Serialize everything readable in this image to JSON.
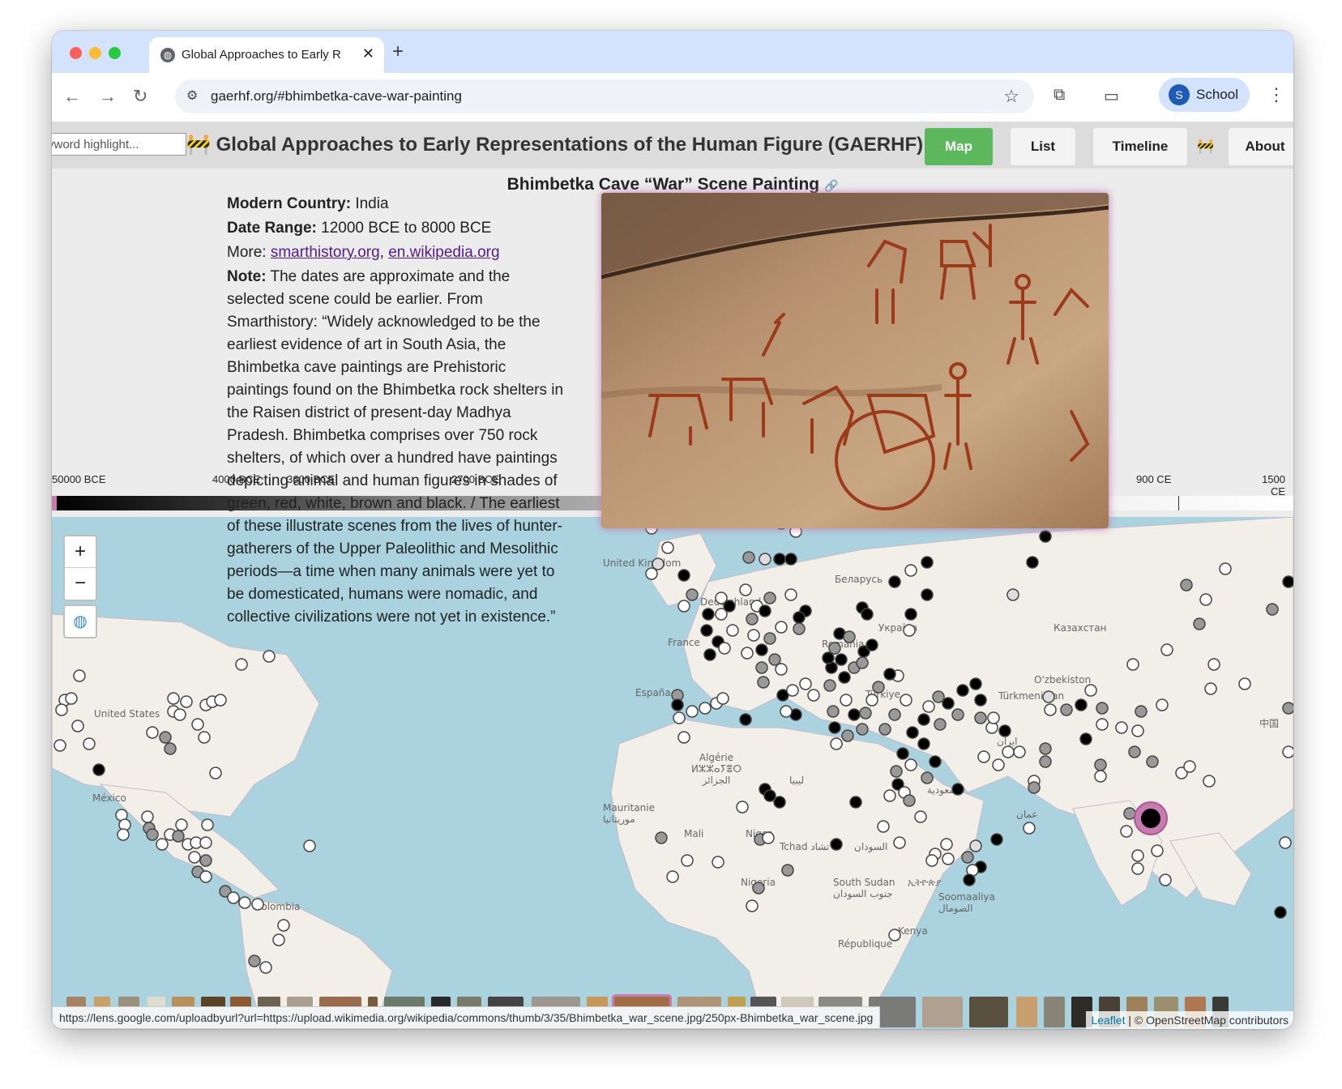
{
  "browser": {
    "tab_title": "Global Approaches to Early R",
    "url": "gaerhf.org/#bhimbetka-cave-war-painting",
    "profile_initial": "S",
    "profile_name": "School"
  },
  "site": {
    "keyword_placeholder": "Keyword highlight...",
    "keyword_visible": "yword highlight...",
    "title": "Global Approaches to Early Representations of the Human Figure (GAERHF)",
    "buttons": {
      "map": "Map",
      "list": "List",
      "timeline": "Timeline",
      "about": "About"
    }
  },
  "detail": {
    "title": "Bhimbetka Cave “War” Scene Painting",
    "country_label": "Modern Country:",
    "country": "India",
    "date_label": "Date Range:",
    "date_range": "12000 BCE to 8000 BCE",
    "more_label": "More:",
    "links": [
      "smarthistory.org",
      "en.wikipedia.org"
    ],
    "note_label": "Note:",
    "note": "The dates are approximate and the selected scene could be earlier. From Smarthistory: “Widely acknowledged to be the earliest evidence of art in South Asia, the Bhimbetka cave paintings are Prehistoric paintings found on the Bhimbetka rock shelters in the Raisen district of present-day Madhya Pradesh. Bhimbetka comprises over 750 rock shelters, of which over a hundred have paintings depicting animal and human figures in shades of green, red, white, brown and black. / The earliest of these illustrate scenes from the lives of hunter-gatherers of the Upper Paleolithic and Mesolithic periods—a time when many animals were yet to be domesticated, humans were nomadic, and collective civilizations were not yet in existence.”"
  },
  "timeline": {
    "labels": [
      "50000 BCE",
      "4000 BCE",
      "3600 BCE",
      "2700 BCE",
      "900 CE",
      "1500 CE"
    ]
  },
  "map": {
    "zoom_in": "+",
    "zoom_out": "−",
    "labels": [
      "United Kingdom",
      "Deutschland",
      "France",
      "España",
      "Беларусь",
      "Україна",
      "Казахстан",
      "O'zbekiston",
      "Türkmenistan",
      "Algérie ⵍⵣⵣⴰⵢⴻⵔ الجزائر",
      "ليبيا",
      "Mauritanie موريتانيا",
      "Mali",
      "Niger",
      "Tchad تشاد",
      "السودان",
      "Nigeria",
      "South Sudan جنوب السودان",
      "ኢትዮጵያ",
      "Soomaaliya الصومال",
      "Kenya",
      "République",
      "United States",
      "México",
      "Colombia",
      "中国",
      "ایران",
      "عمان",
      "السعودية",
      "Türkiye",
      "România"
    ],
    "attribution_leaflet": "Leaflet",
    "attribution_osm": "| © OpenStreetMap contributors"
  },
  "status_url": "https://lens.google.com/uploadbyurl?url=https://upload.wikimedia.org/wikipedia/commons/thumb/3/35/Bhimbetka_war_scene.jpg/250px-Bhimbetka_war_scene.jpg",
  "colors": {
    "map_water": "#aad3df",
    "active_button": "#5cb85c",
    "highlight": "#c77bb0"
  }
}
